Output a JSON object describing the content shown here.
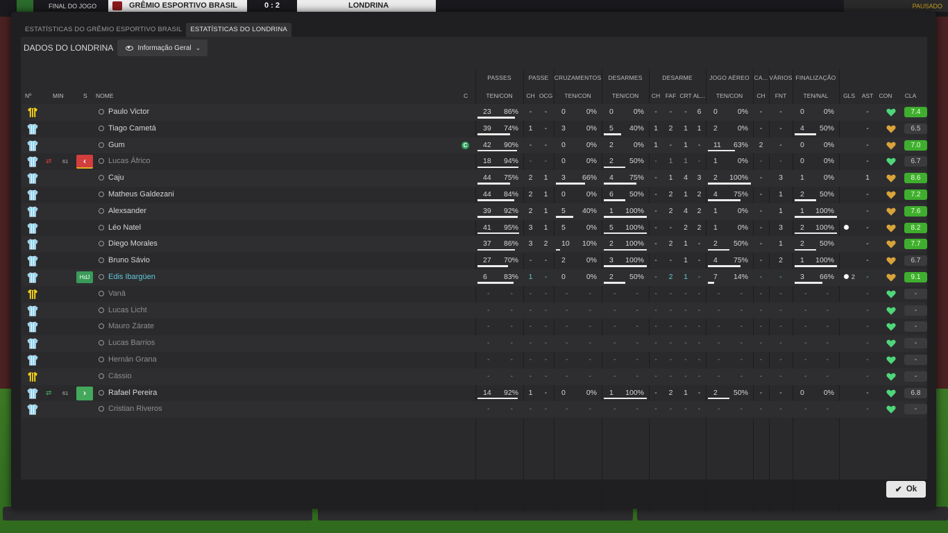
{
  "scorebar": {
    "status": "FINAL DO JOGO",
    "home": "GRÊMIO ESPORTIVO BRASIL",
    "score": "0 : 2",
    "away": "LONDRINA",
    "right": "PAUSADO"
  },
  "tabs": [
    {
      "label": "ESTATÍSTICAS DO GRÊMIO ESPORTIVO BRASIL",
      "active": false
    },
    {
      "label": "ESTATÍSTICAS DO LONDRINA",
      "active": true
    }
  ],
  "panel": {
    "title": "DADOS DO LONDRINA",
    "dropdown": "Informação Geral"
  },
  "groups": [
    "PASSES",
    "PASSE",
    "CRUZAMENTOS",
    "DESARMES",
    "DESARME",
    "JOGO AÉREO",
    "CA...",
    "VÁRIOS",
    "FINALIZAÇÃO"
  ],
  "columns": {
    "no": "Nº",
    "min": "MIN",
    "s": "S",
    "name": "NOME",
    "c": "C",
    "passes": "TEN/CON",
    "passe_ch": "CH",
    "passe_ocg": "OCG",
    "cruz": "TEN/CON",
    "desarmes": "TEN/CON",
    "des_ch": "CH",
    "des_faf": "FAF",
    "des_crt": "CRT",
    "des_al": "AL...",
    "aereo": "TEN/CON",
    "ca_ch": "CH",
    "varios_fnt": "FNT",
    "final": "TEN/NAL",
    "gls": "GLS",
    "ast": "AST",
    "con": "CON",
    "cla": "CLA"
  },
  "players": [
    {
      "name": "Paulo Victor",
      "kit": "gk",
      "p": [
        "23",
        "86%",
        0.86
      ],
      "pch": "-",
      "ocg": "-",
      "cr": [
        "0",
        "0%",
        0
      ],
      "de": [
        "0",
        "0%",
        0
      ],
      "dch": "-",
      "faf": "-",
      "crt": "-",
      "al": "6",
      "ae": [
        "0",
        "0%",
        0
      ],
      "cach": "-",
      "fnt": "-",
      "fi": [
        "0",
        "0%",
        0
      ],
      "gls": "",
      "ast": "-",
      "heart": "green",
      "cla": "7.4",
      "claType": "g"
    },
    {
      "name": "Tiago Cametá",
      "kit": "out",
      "p": [
        "39",
        "74%",
        0.74
      ],
      "pch": "1",
      "ocg": "-",
      "cr": [
        "3",
        "0%",
        0
      ],
      "de": [
        "5",
        "40%",
        0.4
      ],
      "dch": "1",
      "faf": "2",
      "crt": "1",
      "al": "1",
      "ae": [
        "2",
        "0%",
        0
      ],
      "cach": "-",
      "fnt": "-",
      "fi": [
        "4",
        "50%",
        0.5
      ],
      "gls": "",
      "ast": "-",
      "heart": "gold",
      "cla": "6.5",
      "claType": "n"
    },
    {
      "name": "Gum",
      "kit": "out",
      "captain": true,
      "p": [
        "42",
        "90%",
        0.9
      ],
      "pch": "-",
      "ocg": "-",
      "cr": [
        "0",
        "0%",
        0
      ],
      "de": [
        "2",
        "0%",
        0
      ],
      "dch": "1",
      "faf": "-",
      "crt": "1",
      "al": "-",
      "ae": [
        "11",
        "63%",
        0.63
      ],
      "cach": "2",
      "fnt": "-",
      "fi": [
        "0",
        "0%",
        0
      ],
      "gls": "",
      "ast": "-",
      "heart": "gold",
      "cla": "7.0",
      "claType": "g"
    },
    {
      "name": "Lucas Áfrico",
      "kit": "out",
      "dim": true,
      "subOut": true,
      "min": "61",
      "p": [
        "18",
        "94%",
        0.94
      ],
      "pch": "-",
      "ocg": "-",
      "cr": [
        "0",
        "0%",
        0
      ],
      "de": [
        "2",
        "50%",
        0.5
      ],
      "dch": "-",
      "faf": "1",
      "crt": "1",
      "al": "-",
      "ae": [
        "1",
        "0%",
        0
      ],
      "cach": "-",
      "fnt": "-",
      "fi": [
        "0",
        "0%",
        0
      ],
      "gls": "",
      "ast": "-",
      "heart": "green",
      "cla": "6.7",
      "claType": "n"
    },
    {
      "name": "Caju",
      "kit": "out",
      "p": [
        "44",
        "75%",
        0.75
      ],
      "pch": "2",
      "ocg": "1",
      "cr": [
        "3",
        "66%",
        0.66
      ],
      "de": [
        "4",
        "75%",
        0.75
      ],
      "dch": "-",
      "faf": "1",
      "crt": "4",
      "al": "3",
      "ae": [
        "2",
        "100%",
        1
      ],
      "cach": "-",
      "fnt": "3",
      "fi": [
        "1",
        "0%",
        0
      ],
      "gls": "",
      "ast": "1",
      "heart": "gold",
      "cla": "8.6",
      "claType": "g"
    },
    {
      "name": "Matheus Galdezani",
      "kit": "out",
      "p": [
        "44",
        "84%",
        0.84
      ],
      "pch": "2",
      "ocg": "1",
      "cr": [
        "0",
        "0%",
        0
      ],
      "de": [
        "6",
        "50%",
        0.5
      ],
      "dch": "-",
      "faf": "2",
      "crt": "1",
      "al": "2",
      "ae": [
        "4",
        "75%",
        0.75
      ],
      "cach": "-",
      "fnt": "1",
      "fi": [
        "2",
        "50%",
        0.5
      ],
      "gls": "",
      "ast": "-",
      "heart": "gold",
      "cla": "7.2",
      "claType": "g"
    },
    {
      "name": "Alexsander",
      "kit": "out",
      "p": [
        "39",
        "92%",
        0.92
      ],
      "pch": "2",
      "ocg": "1",
      "cr": [
        "5",
        "40%",
        0.4
      ],
      "de": [
        "1",
        "100%",
        1
      ],
      "dch": "-",
      "faf": "2",
      "crt": "4",
      "al": "2",
      "ae": [
        "1",
        "0%",
        0
      ],
      "cach": "-",
      "fnt": "1",
      "fi": [
        "1",
        "100%",
        1
      ],
      "gls": "",
      "ast": "-",
      "heart": "gold",
      "cla": "7.6",
      "claType": "g"
    },
    {
      "name": "Léo Natel",
      "kit": "out",
      "p": [
        "41",
        "95%",
        0.95
      ],
      "pch": "3",
      "ocg": "1",
      "cr": [
        "5",
        "0%",
        0
      ],
      "de": [
        "5",
        "100%",
        1
      ],
      "dch": "-",
      "faf": "-",
      "crt": "2",
      "al": "2",
      "ae": [
        "1",
        "0%",
        0
      ],
      "cach": "-",
      "fnt": "3",
      "fi": [
        "2",
        "100%",
        1
      ],
      "gls": "ball",
      "ast": "-",
      "heart": "gold",
      "cla": "8.2",
      "claType": "g"
    },
    {
      "name": "Diego Morales",
      "kit": "out",
      "p": [
        "37",
        "86%",
        0.86
      ],
      "pch": "3",
      "ocg": "2",
      "cr": [
        "10",
        "10%",
        0.1
      ],
      "de": [
        "2",
        "100%",
        1
      ],
      "dch": "-",
      "faf": "2",
      "crt": "1",
      "al": "-",
      "ae": [
        "2",
        "50%",
        0.5
      ],
      "cach": "-",
      "fnt": "1",
      "fi": [
        "2",
        "50%",
        0.5
      ],
      "gls": "",
      "ast": "-",
      "heart": "gold",
      "cla": "7.7",
      "claType": "g"
    },
    {
      "name": "Bruno Sávio",
      "kit": "out",
      "p": [
        "27",
        "70%",
        0.7
      ],
      "pch": "-",
      "ocg": "-",
      "cr": [
        "2",
        "0%",
        0
      ],
      "de": [
        "3",
        "100%",
        1
      ],
      "dch": "-",
      "faf": "-",
      "crt": "1",
      "al": "-",
      "ae": [
        "4",
        "75%",
        0.75
      ],
      "cach": "-",
      "fnt": "2",
      "fi": [
        "1",
        "100%",
        1
      ],
      "gls": "",
      "ast": "-",
      "heart": "gold",
      "cla": "6.7",
      "claType": "n"
    },
    {
      "name": "Edis Ibargüen",
      "kit": "out",
      "teal": true,
      "hdj": "HdJ",
      "p": [
        "6",
        "83%",
        0.83
      ],
      "pch": "1",
      "ocg": "-",
      "cr": [
        "0",
        "0%",
        0
      ],
      "de": [
        "2",
        "50%",
        0.5
      ],
      "dch": "-",
      "faf": "2",
      "crt": "1",
      "al": "-",
      "ae": [
        "7",
        "14%",
        0.14
      ],
      "cach": "-",
      "fnt": "-",
      "fi": [
        "3",
        "66%",
        0.66
      ],
      "gls": "ball2",
      "ast": "-",
      "heart": "gold",
      "cla": "9.1",
      "claType": "g"
    },
    {
      "name": "Vaná",
      "kit": "gk",
      "dim": true,
      "empty": true,
      "heart": "green",
      "cla": "-",
      "claType": "n"
    },
    {
      "name": "Lucas Licht",
      "kit": "out",
      "dim": true,
      "empty": true,
      "heart": "green",
      "cla": "-",
      "claType": "n"
    },
    {
      "name": "Mauro Zárate",
      "kit": "out",
      "dim": true,
      "empty": true,
      "heart": "green",
      "cla": "-",
      "claType": "n"
    },
    {
      "name": "Lucas Barrios",
      "kit": "out",
      "dim": true,
      "empty": true,
      "heart": "green",
      "cla": "-",
      "claType": "n"
    },
    {
      "name": "Hernán Grana",
      "kit": "out",
      "dim": true,
      "empty": true,
      "heart": "green",
      "cla": "-",
      "claType": "n"
    },
    {
      "name": "Cássio",
      "kit": "gk",
      "dim": true,
      "empty": true,
      "heart": "green",
      "cla": "-",
      "claType": "n"
    },
    {
      "name": "Rafael Pereira",
      "kit": "out",
      "subIn": true,
      "min": "61",
      "p": [
        "14",
        "92%",
        0.92
      ],
      "pch": "1",
      "ocg": "-",
      "cr": [
        "0",
        "0%",
        0
      ],
      "de": [
        "1",
        "100%",
        1
      ],
      "dch": "-",
      "faf": "2",
      "crt": "1",
      "al": "-",
      "ae": [
        "2",
        "50%",
        0.5
      ],
      "cach": "-",
      "fnt": "-",
      "fi": [
        "0",
        "0%",
        0
      ],
      "gls": "",
      "ast": "-",
      "heart": "green",
      "cla": "6.8",
      "claType": "n"
    },
    {
      "name": "Cristian Riveros",
      "kit": "out",
      "dim": true,
      "empty": true,
      "heart": "green",
      "cla": "-",
      "claType": "n"
    }
  ],
  "ok_label": "Ok",
  "colors": {
    "accent_green": "#3fae2e",
    "heart_green": "#4fd67a",
    "heart_gold": "#d9a23a",
    "sub_out": "#d23d3d",
    "sub_in": "#44a85c",
    "teal_text": "#5fc8d8"
  },
  "icons": {
    "shirt_gk": "goalkeeper-shirt-icon",
    "shirt_out": "outfield-shirt-icon",
    "heart": "morale-heart-icon",
    "ball": "goal-ball-icon",
    "person": "player-person-icon",
    "eye": "eye-icon"
  }
}
